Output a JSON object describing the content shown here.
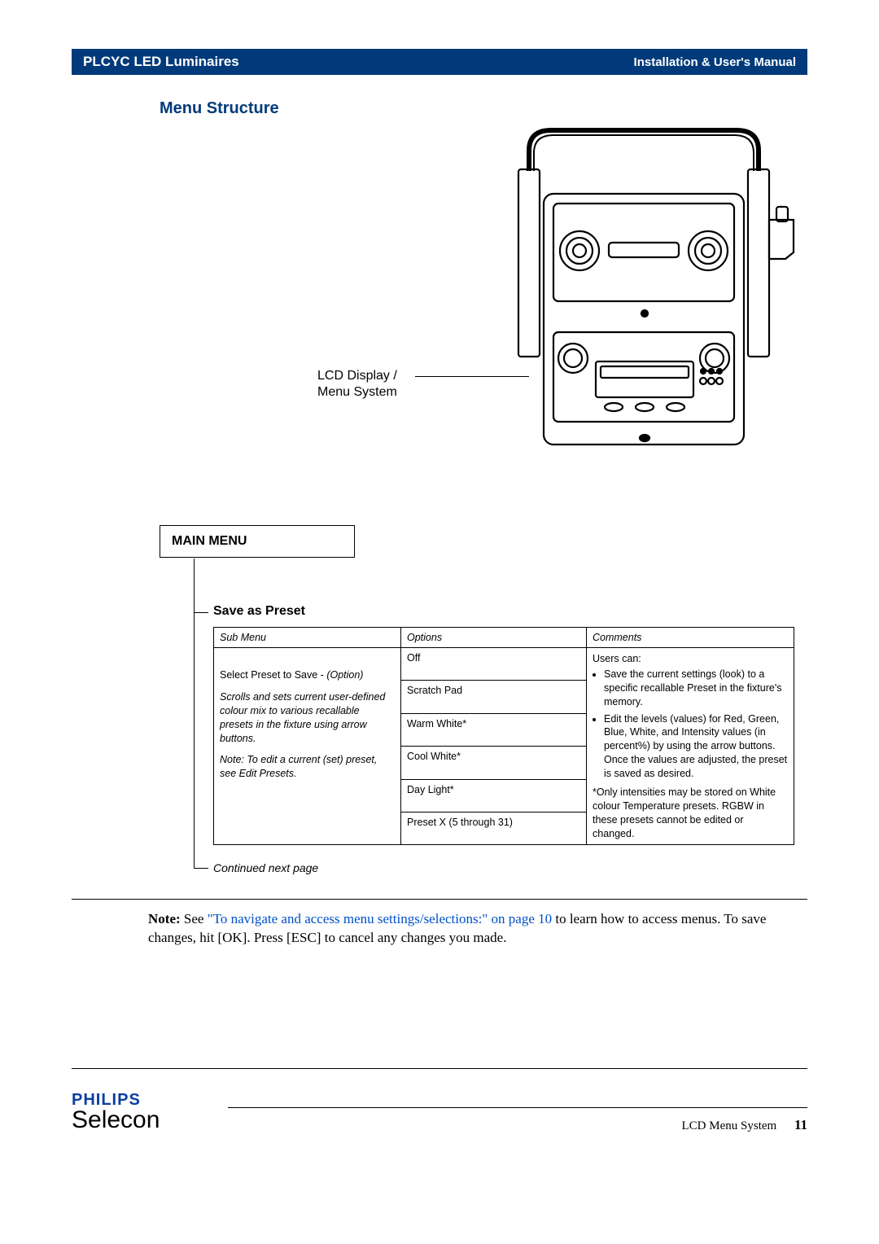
{
  "header": {
    "left": "PLCYC LED Luminaires",
    "right": "Installation & User's Manual"
  },
  "section_title": "Menu Structure",
  "lcd_label_line1": "LCD Display /",
  "lcd_label_line2": "Menu System",
  "main_menu_label": "MAIN MENU",
  "submenu_title": "Save as Preset",
  "table": {
    "headers": {
      "c1": "Sub Menu",
      "c2": "Options",
      "c3": "Comments"
    },
    "submenu_html": {
      "line1": "Select Preset to Save - ",
      "line1_ital": "(Option)",
      "ital1": "Scrolls and sets current user-defined colour mix to various recallable presets in the fixture using arrow buttons.",
      "ital2": "Note: To edit a current (set) preset, see Edit Presets."
    },
    "options": [
      "Off",
      "Scratch Pad",
      "Warm White*",
      "Cool White*",
      "Day Light*",
      "Preset X (5 through 31)"
    ],
    "comments": {
      "intro": "Users can:",
      "bullets": [
        "Save the current settings (look) to a specific recallable Preset in the fixture's memory.",
        "Edit the levels (values) for Red, Green, Blue, White, and Intensity values (in percent%) by using the arrow buttons. Once the values are adjusted, the preset is saved as desired."
      ],
      "footnote": "*Only intensities may be stored on White colour Temperature presets. RGBW in these presets cannot be edited or changed."
    }
  },
  "continued": "Continued next page",
  "note": {
    "label": "Note:",
    "pre": "  See ",
    "link": "\"To navigate and access menu settings/selections:\" on page 10",
    "post": " to learn how to access menus. To save changes, hit [OK]. Press [ESC] to cancel any changes you made."
  },
  "brand": {
    "philips": "PHILIPS",
    "selecon": "Selecon"
  },
  "footer": {
    "section": "LCD Menu System",
    "page": "11"
  }
}
